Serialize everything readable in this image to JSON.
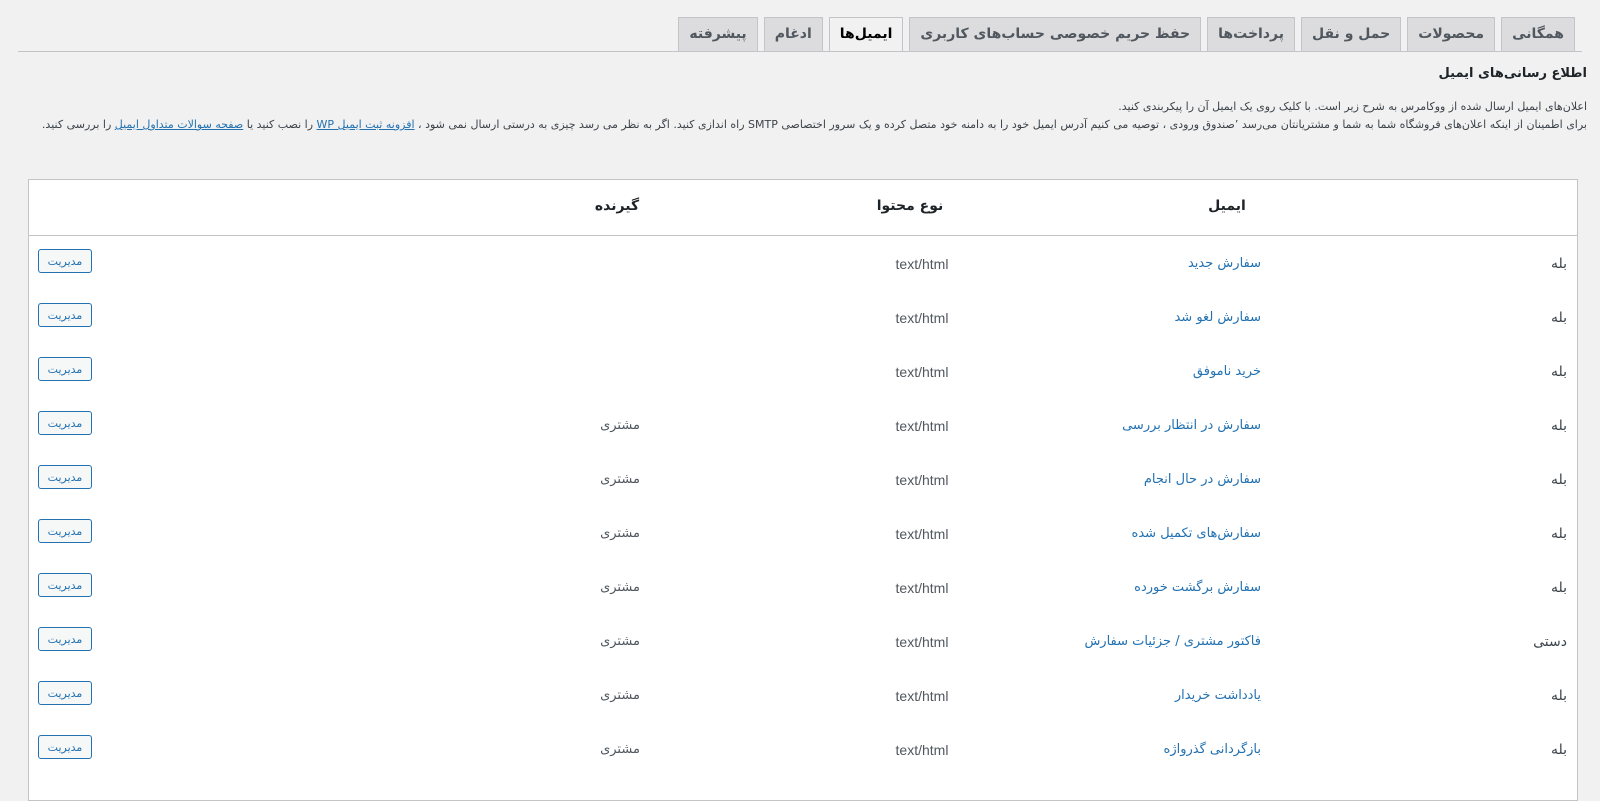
{
  "tabs": [
    {
      "label": "همگانی",
      "active": false
    },
    {
      "label": "محصولات",
      "active": false
    },
    {
      "label": "حمل و نقل",
      "active": false
    },
    {
      "label": "پرداخت‌ها",
      "active": false
    },
    {
      "label": "حفظ حریم خصوصی حساب‌های کاربری",
      "active": false
    },
    {
      "label": "ایمیل‌ها",
      "active": true
    },
    {
      "label": "ادغام",
      "active": false
    },
    {
      "label": "پیشرفته",
      "active": false
    }
  ],
  "section": {
    "title": "اطلاع رسانی‌های ایمیل",
    "desc_line1": "اعلان‌های ایمیل ارسال شده از ووکامرس به شرح زیر است. با کلیک روی یک ایمیل آن را پیکربندی کنید.",
    "desc_line2a": "برای اطمینان از اینکه اعلان‌های فروشگاه شما به شما و مشتریانتان می‌رسد ٬صندوق ورودی ، توصیه می کنیم آدرس ایمیل خود را به دامنه خود متصل کرده و یک سرور اختصاصی SMTP راه اندازی کنید. اگر به نظر می رسد چیزی به درستی ارسال نمی شود ، ",
    "desc_link1": "افزونه ثبت ایمیل WP",
    "desc_line2b": " را نصب کنید یا ",
    "desc_link2": "صفحه سوالات متداول ایمیل",
    "desc_line2c": " را بررسی کنید."
  },
  "table": {
    "headers": {
      "email": "ایمیل",
      "content_type": "نوع محتوا",
      "recipient": "گیرنده"
    },
    "manage_label": "مدیریت",
    "rows": [
      {
        "status": "بله",
        "email": "سفارش جدید",
        "type": "text/html",
        "recipient": ""
      },
      {
        "status": "بله",
        "email": "سفارش لغو شد",
        "type": "text/html",
        "recipient": ""
      },
      {
        "status": "بله",
        "email": "خرید ناموفق",
        "type": "text/html",
        "recipient": ""
      },
      {
        "status": "بله",
        "email": "سفارش در انتظار بررسی",
        "type": "text/html",
        "recipient": "مشتری"
      },
      {
        "status": "بله",
        "email": "سفارش در حال انجام",
        "type": "text/html",
        "recipient": "مشتری"
      },
      {
        "status": "بله",
        "email": "سفارش‌های تکمیل شده",
        "type": "text/html",
        "recipient": "مشتری"
      },
      {
        "status": "بله",
        "email": "سفارش برگشت خورده",
        "type": "text/html",
        "recipient": "مشتری"
      },
      {
        "status": "دستی",
        "email": "فاکتور مشتری / جزئیات سفارش",
        "type": "text/html",
        "recipient": "مشتری"
      },
      {
        "status": "بله",
        "email": "یادداشت خریدار",
        "type": "text/html",
        "recipient": "مشتری"
      },
      {
        "status": "بله",
        "email": "بازگردانی گذرواژه",
        "type": "text/html",
        "recipient": "مشتری"
      }
    ]
  },
  "colors": {
    "link": "#2271b1",
    "background": "#f1f1f1"
  }
}
